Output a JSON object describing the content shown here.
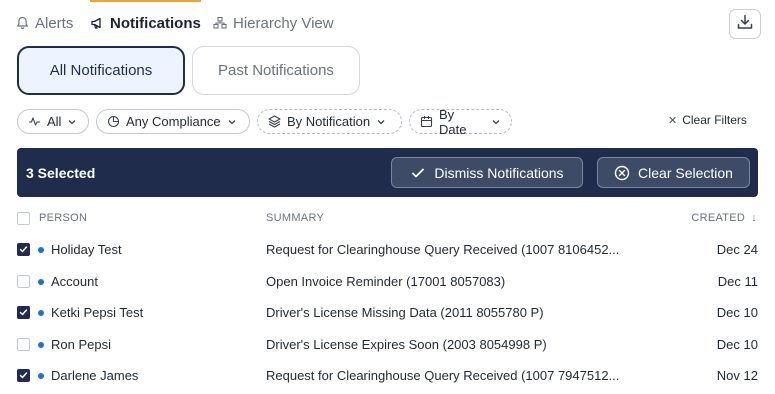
{
  "tabs": {
    "alerts": "Alerts",
    "notifications": "Notifications",
    "hierarchy": "Hierarchy View"
  },
  "segments": {
    "all": "All Notifications",
    "past": "Past Notifications"
  },
  "filters": {
    "all": "All",
    "compliance": "Any Compliance",
    "by_notification": "By Notification",
    "by_date": "By Date",
    "clear": "Clear Filters"
  },
  "selection": {
    "count_label": "3 Selected",
    "dismiss": "Dismiss Notifications",
    "clear": "Clear Selection"
  },
  "table": {
    "headers": {
      "person": "PERSON",
      "summary": "SUMMARY",
      "created": "CREATED"
    },
    "rows": [
      {
        "person": "Holiday Test",
        "summary": "Request for Clearinghouse Query Received (1007 8106452...",
        "created": "Dec 24",
        "checked": true
      },
      {
        "person": "Account",
        "summary": "Open Invoice Reminder (17001 8057083)",
        "created": "Dec 11",
        "checked": false
      },
      {
        "person": "Ketki Pepsi Test",
        "summary": "Driver's License Missing Data (2011 8055780 P)",
        "created": "Dec 10",
        "checked": true
      },
      {
        "person": "Ron Pepsi",
        "summary": "Driver's License Expires Soon (2003 8054998 P)",
        "created": "Dec 10",
        "checked": false
      },
      {
        "person": "Darlene James",
        "summary": "Request for Clearinghouse Query Received (1007 7947512...",
        "created": "Nov 12",
        "checked": true
      }
    ]
  },
  "icons": {
    "alerts": "bell-icon",
    "notifications": "megaphone-icon",
    "hierarchy": "hierarchy-icon",
    "download": "download-icon"
  },
  "colors": {
    "accent": "#f5a524",
    "navy": "#1f2c4c",
    "dot": "#1e73c8"
  }
}
